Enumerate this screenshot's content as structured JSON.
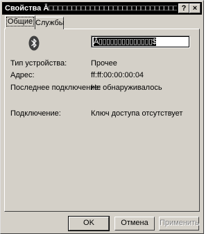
{
  "window": {
    "title": "Свойства Ā□□□□□□□□□□□□□□□□□□□□□□□□□□□□",
    "help_label": "?",
    "close_label": "×"
  },
  "tabs": [
    {
      "label": "Общие",
      "selected": true
    },
    {
      "label": "Службы",
      "selected": false
    }
  ],
  "device": {
    "icon": "bluetooth-icon",
    "name_value": "Ā▯▯▯▯▯▯▯▯▯▯▯▯▯▯$"
  },
  "properties": [
    {
      "label": "Тип устройства:",
      "value": "Прочее"
    },
    {
      "label": "Адрес:",
      "value": "ff:ff:00:00:00:04"
    },
    {
      "label": "Последнее подключение:",
      "value": "Не обнаруживалось"
    },
    {
      "label": "Подключение:",
      "value": "Ключ доступа отсутствует"
    }
  ],
  "buttons": {
    "ok": "OK",
    "cancel": "Отмена",
    "apply": "Применить"
  },
  "colors": {
    "face": "#d4d0c8",
    "titlebar": "#000000",
    "disabled_text": "#808080"
  }
}
